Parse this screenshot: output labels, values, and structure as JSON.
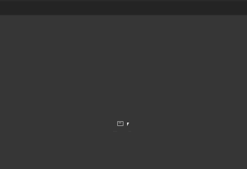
{
  "window": {
    "title": ""
  },
  "content": {
    "empty_state": {
      "left_label": "······",
      "right_label": "····"
    }
  },
  "colors": {
    "background": "#363636",
    "title_bar": "#242424",
    "icon": "#9a9a9a",
    "cursor": "#e0e0e0"
  },
  "icons": {
    "empty_state_icon": "image-icon",
    "cursor": "pointer-icon"
  }
}
